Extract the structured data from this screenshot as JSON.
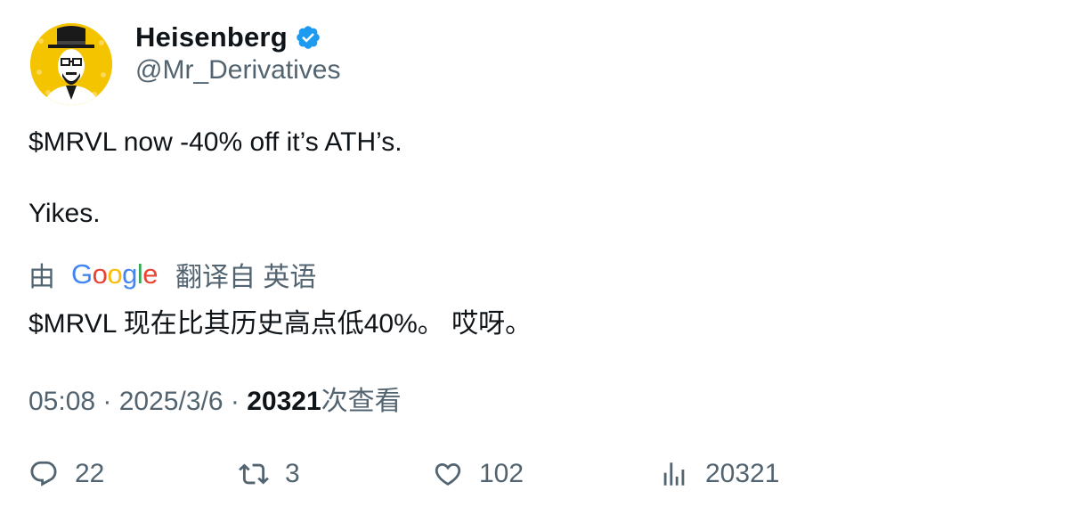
{
  "author": {
    "display_name": "Heisenberg",
    "handle": "@Mr_Derivatives",
    "verified_icon": "verified-badge-icon",
    "verified_color": "#1d9bf0",
    "avatar_bg": "#f5c400"
  },
  "tweet": {
    "line1": "$MRVL now -40% off it’s ATH’s.",
    "line2": "Yikes."
  },
  "translation": {
    "prefix": "由",
    "provider": "Google",
    "suffix": "翻译自 英语",
    "text": "$MRVL 现在比其历史高点低40%。 哎呀。"
  },
  "meta": {
    "time": "05:08",
    "separator": "·",
    "date": "2025/3/6",
    "views_count": "20321",
    "views_label": "次查看"
  },
  "actions": {
    "replies": "22",
    "retweets": "3",
    "likes": "102",
    "views": "20321"
  },
  "colors": {
    "text_primary": "#0f1419",
    "text_secondary": "#536471"
  }
}
